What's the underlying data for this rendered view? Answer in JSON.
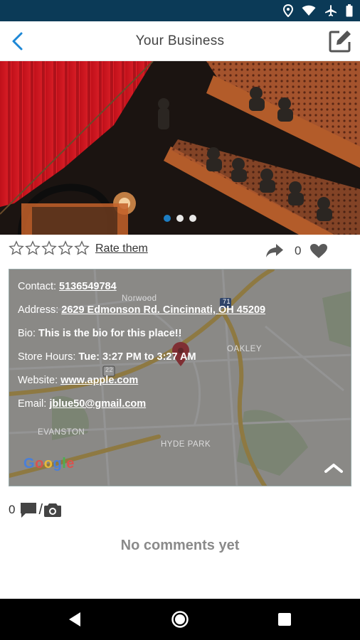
{
  "status_bar": {
    "icons": [
      "location-icon",
      "wifi-icon",
      "airplane-icon",
      "battery-icon"
    ],
    "background": "#0b3a57"
  },
  "app_bar": {
    "title": "Your Business",
    "back_icon": "chevron-left-icon",
    "edit_icon": "edit-icon",
    "accent": "#1e88d6"
  },
  "carousel": {
    "image": "theater-interior-photo",
    "slide_count": 3,
    "active_slide": 1
  },
  "rating": {
    "stars_filled": 0,
    "stars_total": 5,
    "rate_label": "Rate them",
    "likes": "0"
  },
  "info": {
    "contact_label": "Contact: ",
    "contact_value": "5136549784",
    "address_label": "Address: ",
    "address_value": "2629 Edmonson Rd. Cincinnati, OH 45209",
    "bio_label": "Bio: ",
    "bio_value": "This is the bio for this place!!",
    "hours_label": "Store Hours: ",
    "hours_value": "Tue: 3:27 PM to 3:27 AM",
    "website_label": "Website: ",
    "website_value": "www.apple.com",
    "email_label": "Email: ",
    "email_value": "jblue50@gmail.com"
  },
  "map": {
    "labels": {
      "norwood": "Norwood",
      "oakley": "OAKLEY",
      "evanston": "EVANSTON",
      "hyde_park": "HYDE PARK",
      "route_71": "71",
      "route_22": "22"
    },
    "logo": "Google"
  },
  "comments": {
    "count": "0",
    "slash": "/",
    "empty_message": "No comments yet"
  },
  "nav": {
    "buttons": [
      "back-triangle-icon",
      "home-circle-icon",
      "recents-square-icon"
    ]
  }
}
